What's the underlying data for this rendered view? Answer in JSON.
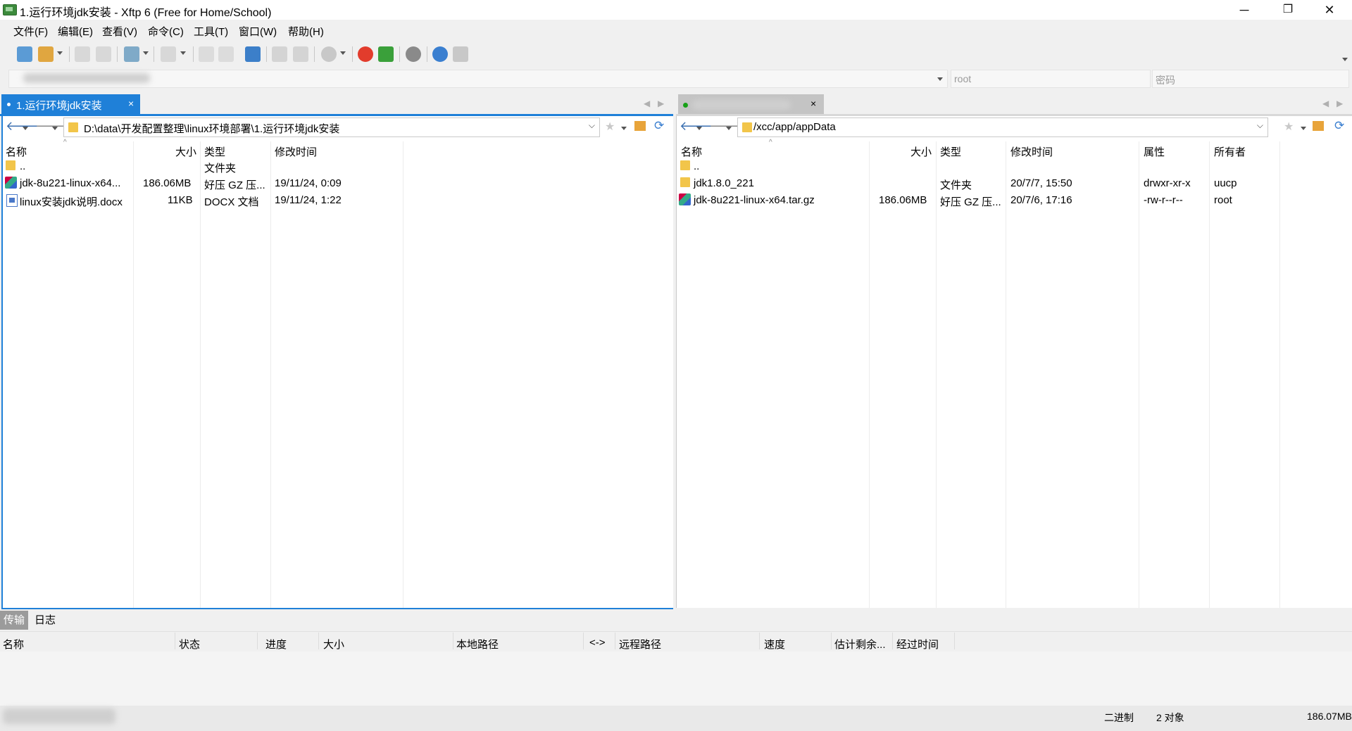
{
  "window": {
    "title": "1.运行环境jdk安装 - Xftp 6 (Free for Home/School)",
    "minimize": "─",
    "restore": "❐",
    "close": "✕"
  },
  "menu": [
    "文件(F)",
    "编辑(E)",
    "查看(V)",
    "命令(C)",
    "工具(T)",
    "窗口(W)",
    "帮助(H)"
  ],
  "address": {
    "user_placeholder": "root",
    "password_placeholder": "密码"
  },
  "left": {
    "tab_label": "1.运行环境jdk安装",
    "tab_close": "×",
    "path": "D:\\data\\开发配置整理\\linux环境部署\\1.运行环境jdk安装",
    "columns": [
      "名称",
      "大小",
      "类型",
      "修改时间"
    ],
    "rows": [
      {
        "name": "..",
        "size": "",
        "type": "文件夹",
        "modified": "",
        "icon": "folder-icon"
      },
      {
        "name": "jdk-8u221-linux-x64...",
        "size": "186.06MB",
        "type": "好压 GZ 压...",
        "modified": "19/11/24, 0:09",
        "icon": "archive-icon"
      },
      {
        "name": "linux安装jdk说明.docx",
        "size": "11KB",
        "type": "DOCX 文档",
        "modified": "19/11/24, 1:22",
        "icon": "docx-icon"
      }
    ]
  },
  "right": {
    "tab_close": "×",
    "path": "/xcc/app/appData",
    "columns": [
      "名称",
      "大小",
      "类型",
      "修改时间",
      "属性",
      "所有者"
    ],
    "rows": [
      {
        "name": "..",
        "size": "",
        "type": "",
        "modified": "",
        "attr": "",
        "owner": "",
        "icon": "folder-icon"
      },
      {
        "name": "jdk1.8.0_221",
        "size": "",
        "type": "文件夹",
        "modified": "20/7/7, 15:50",
        "attr": "drwxr-xr-x",
        "owner": "uucp",
        "icon": "folder-icon"
      },
      {
        "name": "jdk-8u221-linux-x64.tar.gz",
        "size": "186.06MB",
        "type": "好压 GZ 压...",
        "modified": "20/7/6, 17:16",
        "attr": "-rw-r--r--",
        "owner": "root",
        "icon": "archive-icon"
      }
    ]
  },
  "transfer": {
    "tabs": [
      "传输",
      "日志"
    ],
    "columns": [
      "名称",
      "状态",
      "进度",
      "大小",
      "本地路径",
      "<->",
      "远程路径",
      "速度",
      "估计剩余...",
      "经过时间"
    ]
  },
  "status": {
    "mode": "二进制",
    "objects": "2 对象",
    "size": "186.07MB"
  },
  "colors": {
    "accent": "#1f80d8",
    "active_dot": "#17a017"
  }
}
